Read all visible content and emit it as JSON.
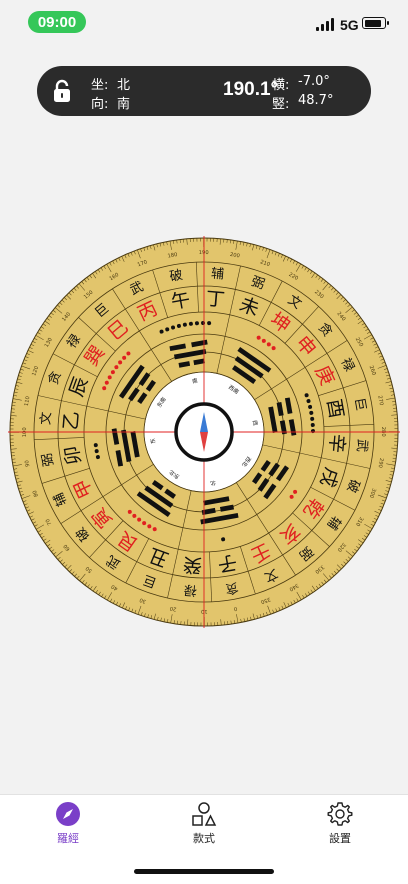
{
  "status_bar": {
    "time": "09:00",
    "network": "5G",
    "signal_bars": 4,
    "battery_level": 0.85
  },
  "info_bar": {
    "sitting_label": "坐:",
    "sitting_value": "北",
    "facing_label": "向:",
    "facing_value": "南",
    "heading": "190.1°",
    "horizontal_label": "横:",
    "horizontal_value": "-7.0°",
    "vertical_label": "竪:",
    "vertical_value": "48.7°"
  },
  "compass": {
    "rotation_deg": 190.1,
    "outer_bg": "#e2c56c",
    "line_color": "#4a3a10",
    "accent": "#e02020",
    "crosshair": "#e02020",
    "degree_labels": [
      "0",
      "10",
      "20",
      "30",
      "40",
      "50",
      "60",
      "70",
      "80",
      "90",
      "100",
      "110",
      "120",
      "130",
      "140",
      "150",
      "160",
      "170",
      "180",
      "190",
      "200",
      "210",
      "220",
      "230",
      "240",
      "250",
      "260",
      "270",
      "280",
      "290",
      "300",
      "310",
      "320",
      "330",
      "340",
      "350"
    ],
    "stars_ring": [
      "贪",
      "禄",
      "巨",
      "武",
      "破",
      "辅",
      "弼",
      "文",
      "贪",
      "禄",
      "巨",
      "武",
      "破",
      "辅",
      "弼",
      "文",
      "贪",
      "禄",
      "巨",
      "武",
      "破",
      "辅",
      "弼",
      "文"
    ],
    "mountains": [
      "子",
      "癸",
      "丑",
      "艮",
      "寅",
      "甲",
      "卯",
      "乙",
      "辰",
      "巽",
      "巳",
      "丙",
      "午",
      "丁",
      "未",
      "坤",
      "申",
      "庚",
      "酉",
      "辛",
      "戌",
      "乾",
      "亥",
      "壬"
    ],
    "mountain_colors": [
      "#111",
      "#111",
      "#111",
      "#e02020",
      "#e02020",
      "#e02020",
      "#111",
      "#111",
      "#111",
      "#e02020",
      "#e02020",
      "#e02020",
      "#111",
      "#111",
      "#111",
      "#e02020",
      "#e02020",
      "#e02020",
      "#111",
      "#111",
      "#111",
      "#e02020",
      "#e02020",
      "#e02020"
    ],
    "dot_patterns": [
      1,
      6,
      3,
      8,
      9,
      4,
      7,
      2
    ],
    "inner_dirs": [
      "北",
      "东北",
      "东",
      "东南",
      "南",
      "西南",
      "西",
      "西北"
    ],
    "trigrams": [
      [
        0,
        1,
        0
      ],
      [
        1,
        0,
        0
      ],
      [
        0,
        0,
        1
      ],
      [
        1,
        1,
        0
      ],
      [
        1,
        0,
        1
      ],
      [
        0,
        0,
        0
      ],
      [
        0,
        1,
        1
      ],
      [
        1,
        1,
        1
      ]
    ]
  },
  "tabs": [
    {
      "label": "羅經",
      "icon": "compass-icon",
      "active": true
    },
    {
      "label": "款式",
      "icon": "shapes-icon",
      "active": false
    },
    {
      "label": "設置",
      "icon": "gear-icon",
      "active": false
    }
  ]
}
